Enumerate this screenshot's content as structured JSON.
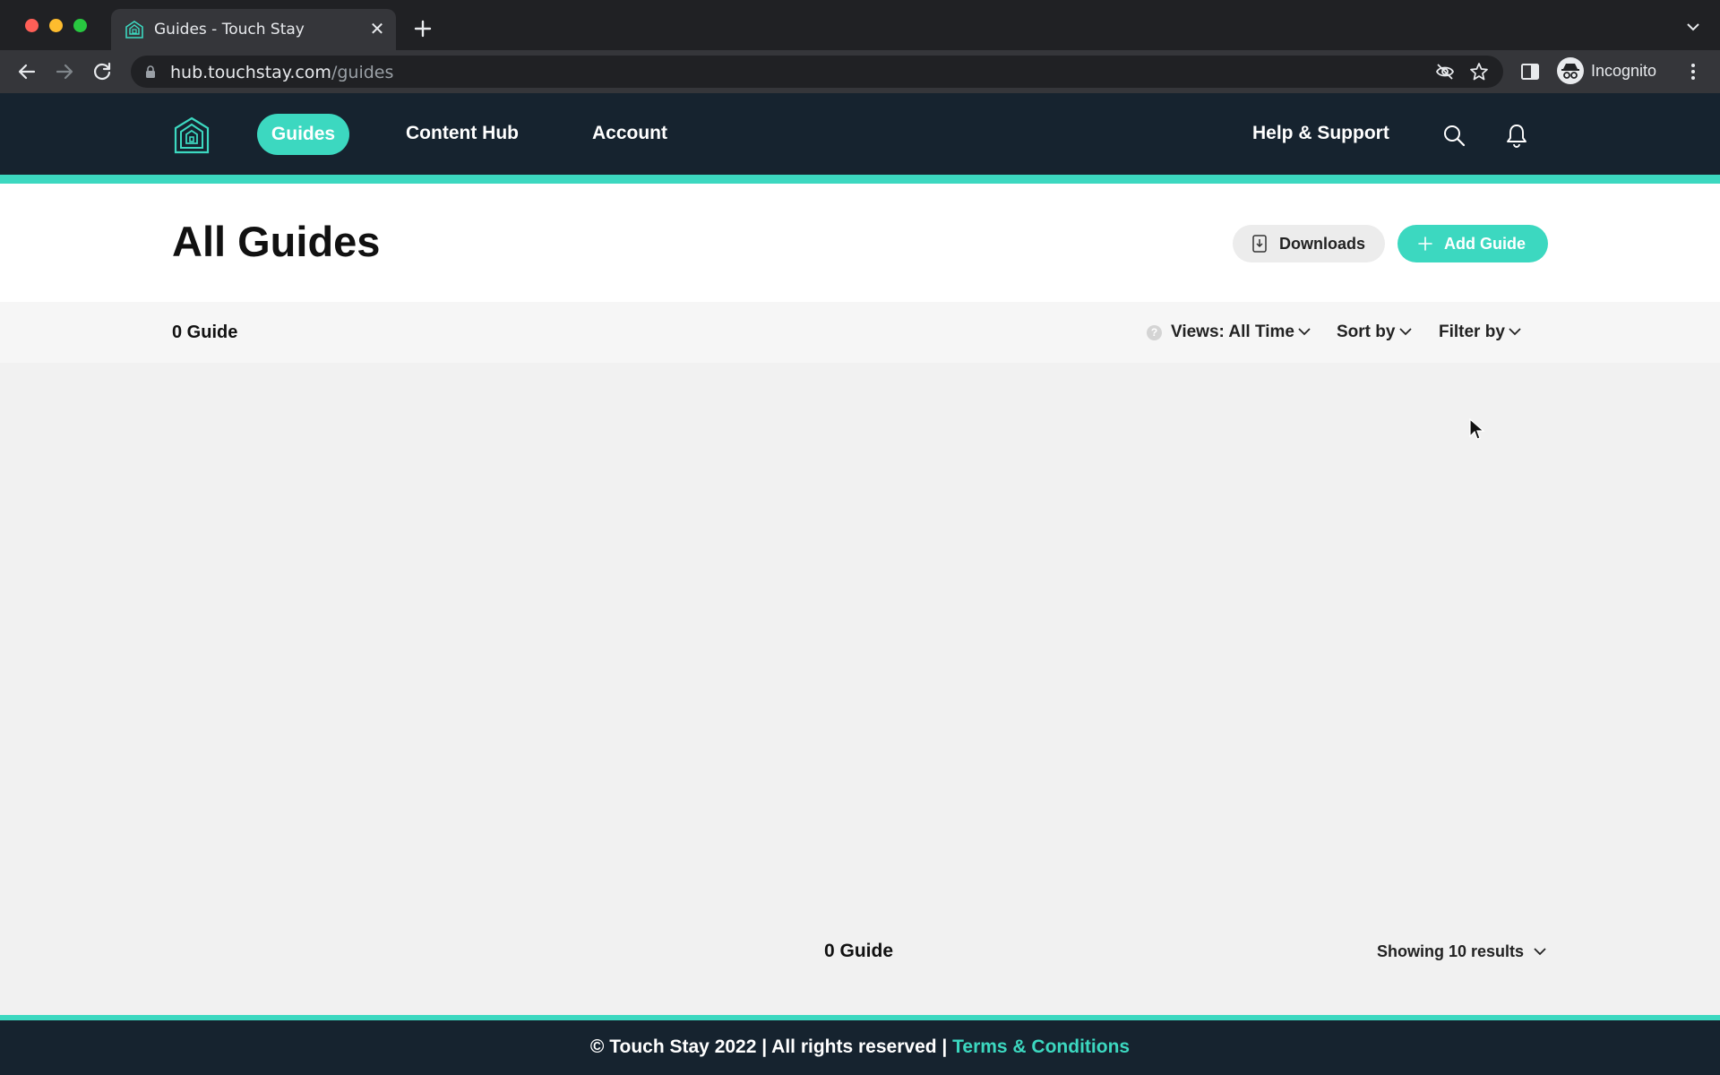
{
  "browser": {
    "tab_title": "Guides - Touch Stay",
    "url_host": "hub.touchstay.com",
    "url_path": "/guides",
    "profile_label": "Incognito"
  },
  "nav": {
    "items": [
      {
        "label": "Guides",
        "active": true
      },
      {
        "label": "Content Hub",
        "active": false
      },
      {
        "label": "Account",
        "active": false
      }
    ],
    "help_label": "Help & Support"
  },
  "page": {
    "title": "All Guides",
    "downloads_label": "Downloads",
    "add_guide_label": "Add Guide"
  },
  "filters": {
    "count_label": "0 Guide",
    "views_label": "Views: All Time",
    "sort_label": "Sort by",
    "filter_label": "Filter by"
  },
  "results": {
    "count_label": "0 Guide",
    "showing_label": "Showing 10 results"
  },
  "footer": {
    "copyright": "© Touch Stay 2022 | All rights reserved | ",
    "terms_label": "Terms & Conditions"
  },
  "colors": {
    "accent": "#3cd8c0",
    "navbar": "#16232f",
    "page_bg": "#f1f1f1"
  }
}
